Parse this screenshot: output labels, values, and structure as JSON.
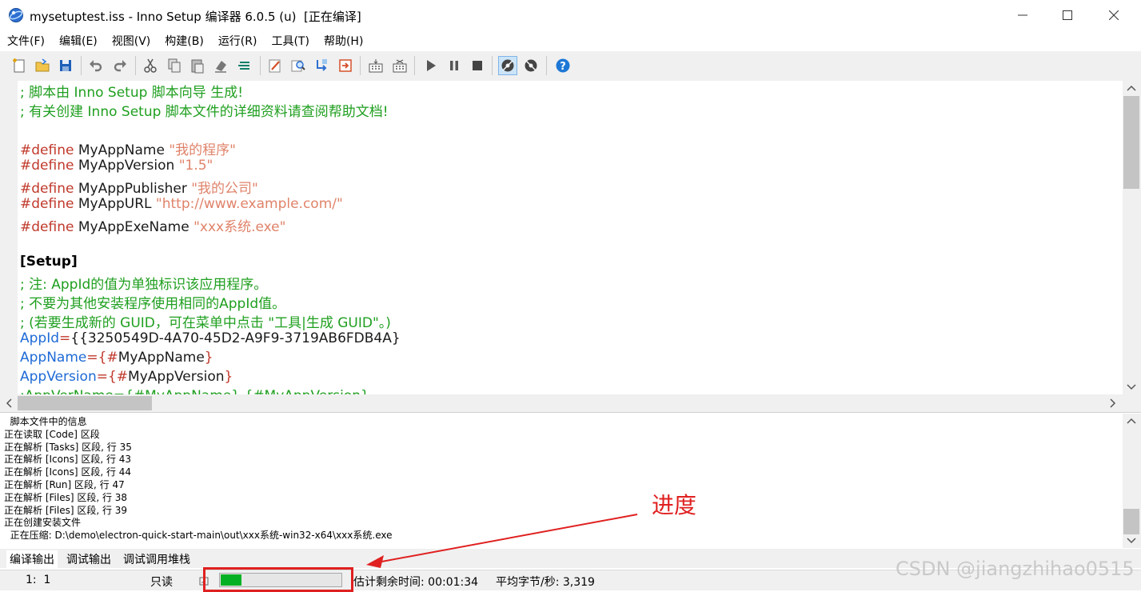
{
  "window": {
    "title": "mysetuptest.iss - Inno Setup 编译器 6.0.5 (u)  [正在编译]",
    "controls": {
      "minimize": "—",
      "maximize": "☐",
      "close": "✕"
    }
  },
  "menu": [
    "文件(F)",
    "编辑(E)",
    "视图(V)",
    "构建(B)",
    "运行(R)",
    "工具(T)",
    "帮助(H)"
  ],
  "toolbar": {
    "icons": [
      "new-icon",
      "open-icon",
      "save-icon",
      "undo-icon",
      "redo-icon",
      "cut-icon",
      "copy-icon",
      "paste-icon",
      "delete-icon",
      "select-all-icon",
      "compile-icon",
      "find-icon",
      "replace-icon",
      "goto-icon",
      "tab-icon",
      "tab-alt-icon",
      "run-icon",
      "pause-icon",
      "stop-icon",
      "target-uninstall-icon",
      "target-setup-icon",
      "help-icon"
    ]
  },
  "editor": {
    "lines": [
      [
        {
          "t": "; 脚本由 Inno Setup 脚本向导 生成!",
          "c": "c-com"
        }
      ],
      [
        {
          "t": "; 有关创建 Inno Setup 脚本文件的详细资料请查阅帮助文档!",
          "c": "c-com"
        }
      ],
      [],
      [
        {
          "t": "#define",
          "c": "c-pre"
        },
        {
          "t": " MyAppName ",
          "c": "c-id"
        },
        {
          "t": "\"我的程序\"",
          "c": "c-str"
        }
      ],
      [
        {
          "t": "#define",
          "c": "c-pre"
        },
        {
          "t": " MyAppVersion ",
          "c": "c-id"
        },
        {
          "t": "\"1.5\"",
          "c": "c-str"
        }
      ],
      [
        {
          "t": "#define",
          "c": "c-pre"
        },
        {
          "t": " MyAppPublisher ",
          "c": "c-id"
        },
        {
          "t": "\"我的公司\"",
          "c": "c-str"
        }
      ],
      [
        {
          "t": "#define",
          "c": "c-pre"
        },
        {
          "t": " MyAppURL ",
          "c": "c-id"
        },
        {
          "t": "\"http://www.example.com/\"",
          "c": "c-str"
        }
      ],
      [
        {
          "t": "#define",
          "c": "c-pre"
        },
        {
          "t": " MyAppExeName ",
          "c": "c-id"
        },
        {
          "t": "\"xxx系统.exe\"",
          "c": "c-str"
        }
      ],
      [],
      [
        {
          "t": "[Setup]",
          "c": "c-sec"
        }
      ],
      [
        {
          "t": "; 注: AppId的值为单独标识该应用程序。",
          "c": "c-com"
        }
      ],
      [
        {
          "t": "; 不要为其他安装程序使用相同的AppId值。",
          "c": "c-com"
        }
      ],
      [
        {
          "t": "; (若要生成新的 GUID，可在菜单中点击 \"工具|生成 GUID\"。)",
          "c": "c-com"
        }
      ],
      [
        {
          "t": "AppId",
          "c": "c-key"
        },
        {
          "t": "=",
          "c": "c-op"
        },
        {
          "t": "{{3250549D-4A70-45D2-A9F9-3719AB6FDB4A}",
          "c": "c-id"
        }
      ],
      [
        {
          "t": "AppName",
          "c": "c-key"
        },
        {
          "t": "=",
          "c": "c-op"
        },
        {
          "t": "{#",
          "c": "c-op"
        },
        {
          "t": "MyAppName",
          "c": "c-id"
        },
        {
          "t": "}",
          "c": "c-op"
        }
      ],
      [
        {
          "t": "AppVersion",
          "c": "c-key"
        },
        {
          "t": "=",
          "c": "c-op"
        },
        {
          "t": "{#",
          "c": "c-op"
        },
        {
          "t": "MyAppVersion",
          "c": "c-id"
        },
        {
          "t": "}",
          "c": "c-op"
        }
      ],
      [
        {
          "t": ";AppVerName={#MyAppName} {#MyAppVersion}",
          "c": "c-com"
        }
      ]
    ]
  },
  "log": {
    "lines": [
      "  脚本文件中的信息",
      "正在读取 [Code] 区段",
      "正在解析 [Tasks] 区段, 行 35",
      "正在解析 [Icons] 区段, 行 43",
      "正在解析 [Icons] 区段, 行 44",
      "正在解析 [Run] 区段, 行 47",
      "正在解析 [Files] 区段, 行 38",
      "正在解析 [Files] 区段, 行 39",
      "正在创建安装文件",
      "  正在压缩: D:\\demo\\electron-quick-start-main\\out\\xxx系统-win32-x64\\xxx系统.exe"
    ]
  },
  "tabs": [
    "编译输出",
    "调试输出",
    "调试调用堆栈"
  ],
  "status": {
    "position": "1:  1",
    "mode": "只读",
    "progress": 0.17,
    "remaining": "估计剩余时间: 00:01:34",
    "rate": "平均字节/秒: 3,319"
  },
  "annotation": {
    "label": "进度",
    "color": "#e02020"
  },
  "watermark": "CSDN @jiangzhihao0515"
}
